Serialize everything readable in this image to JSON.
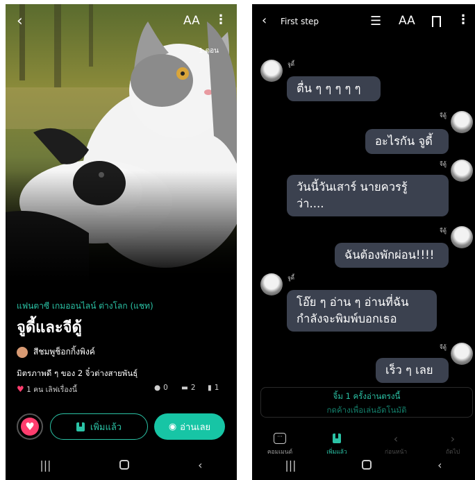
{
  "left": {
    "nav": {
      "back_icon": "‹",
      "font_size_label": "AA",
      "more_icon": "⋮"
    },
    "episode_count": "1 ตอน",
    "genre": "แฟนตาซี เกมออนไลน์ ต่างโลก (แชท)",
    "title": "จูดี้และจีดู้",
    "author": "สีชมพูช็อกกิ้งพิงค์",
    "description": "มิตรภาพดี ๆ ของ 2 จิ๋วต่างสายพันธุ์",
    "likes_text": "1 คน เลิฟเรื่องนี้",
    "stats": {
      "comments": "0",
      "messages": "2",
      "episodes": "1"
    },
    "buttons": {
      "added_label": "เพิ่มแล้ว",
      "read_label": "อ่านเลย"
    },
    "colors": {
      "accent": "#2bc3a6",
      "heart": "#ff3d6e"
    }
  },
  "right": {
    "nav": {
      "back_icon": "‹",
      "title": "First step",
      "list_icon": "☰",
      "font_size_label": "AA",
      "more_icon": "⋮"
    },
    "messages": [
      {
        "side": "left",
        "name": "จูดี้",
        "text": "ตื่น ๆ ๆ ๆ ๆ ๆ"
      },
      {
        "side": "right",
        "name": "จีดู้",
        "text": "อะไรกัน จูดี้"
      },
      {
        "side": "right",
        "name": "จีดู้",
        "text": "วันนี้วันเสาร์ นายควรรู้",
        "text2": "ว่า...."
      },
      {
        "side": "right",
        "name": "จีดู้",
        "text": "ฉันต้องพักผ่อน!!!!"
      },
      {
        "side": "left",
        "name": "จูดี้",
        "text": "โอ๊ย ๆ อ่าน ๆ อ่านที่ฉัน",
        "text2": "กำลังจะพิมพ์บอกเธอ"
      },
      {
        "side": "right",
        "name": "จีดู้",
        "text": "เร็ว ๆ เลย"
      }
    ],
    "notice": {
      "line1": "จิ้ม 1 ครั้งอ่านตรงนี้",
      "line2": "กดค้างเพื่อเล่นอัตโนมัติ"
    },
    "bottom_bar": {
      "comment": "คอมเมนต์",
      "added": "เพิ่มแล้ว",
      "prev": "ก่อนหน้า",
      "next": "ถัดไป"
    }
  },
  "system_nav": {
    "recents": "|||",
    "back": "‹"
  }
}
